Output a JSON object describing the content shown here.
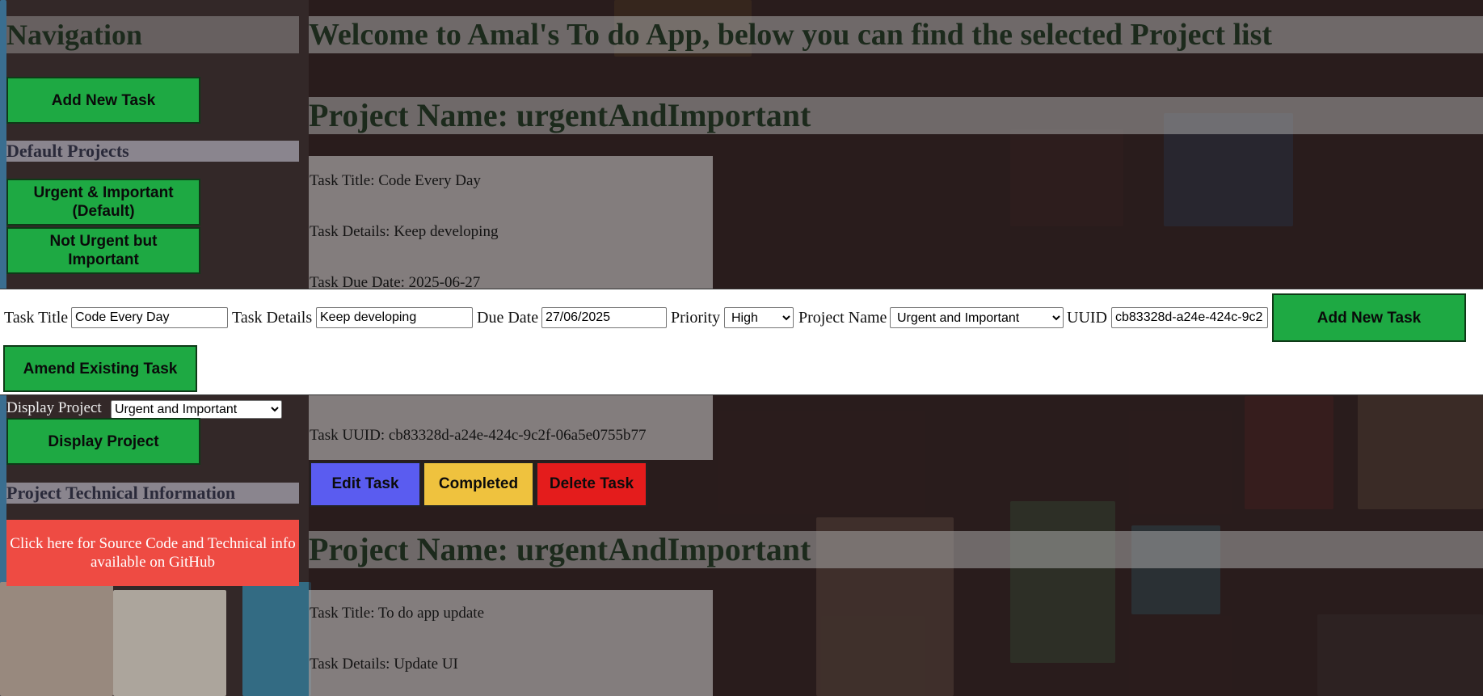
{
  "sidebar": {
    "title": "Navigation",
    "add_task_label": "Add New Task",
    "default_projects_label": "Default Projects",
    "project_buttons": [
      {
        "label": "Urgent & Important (Default)"
      },
      {
        "label": "Not Urgent but Important"
      }
    ],
    "display_project_label": "Display Project",
    "display_project_value": "Urgent and Important",
    "display_project_button": "Display Project",
    "tech_info_label": "Project Technical Information",
    "github_text": "Click here for Source Code and Technical info available on GitHub"
  },
  "main": {
    "welcome": "Welcome to Amal's To do App, below you can find the selected Project list",
    "project_heading": "Project Name: urgentAndImportant",
    "task1": {
      "title": "Task Title: Code Every Day",
      "details": "Task Details: Keep developing",
      "due": "Task Due Date: 2025-06-27",
      "uuid": "Task UUID: cb83328d-a24e-424c-9c2f-06a5e0755b77"
    },
    "actions": {
      "edit": "Edit Task",
      "completed": "Completed",
      "delete": "Delete Task"
    },
    "project_heading_2": "Project Name: urgentAndImportant",
    "task2": {
      "title": "Task Title: To do app update",
      "details": "Task Details: Update UI"
    }
  },
  "form": {
    "task_title_label": "Task Title",
    "task_title_value": "Code Every Day",
    "task_details_label": "Task Details",
    "task_details_value": "Keep developing",
    "due_date_label": "Due Date",
    "due_date_value": "27/06/2025",
    "priority_label": "Priority",
    "priority_value": "High",
    "project_name_label": "Project Name",
    "project_name_value": "Urgent and Important",
    "uuid_label": "UUID",
    "uuid_value": "cb83328d-a24e-424c-9c2",
    "add_button": "Add New Task",
    "amend_button": "Amend Existing Task"
  },
  "colors": {
    "green": "#1ea943",
    "edit": "#5a5cf0",
    "completed": "#efc23e",
    "delete": "#e41c1c",
    "github": "#ee4b43"
  }
}
